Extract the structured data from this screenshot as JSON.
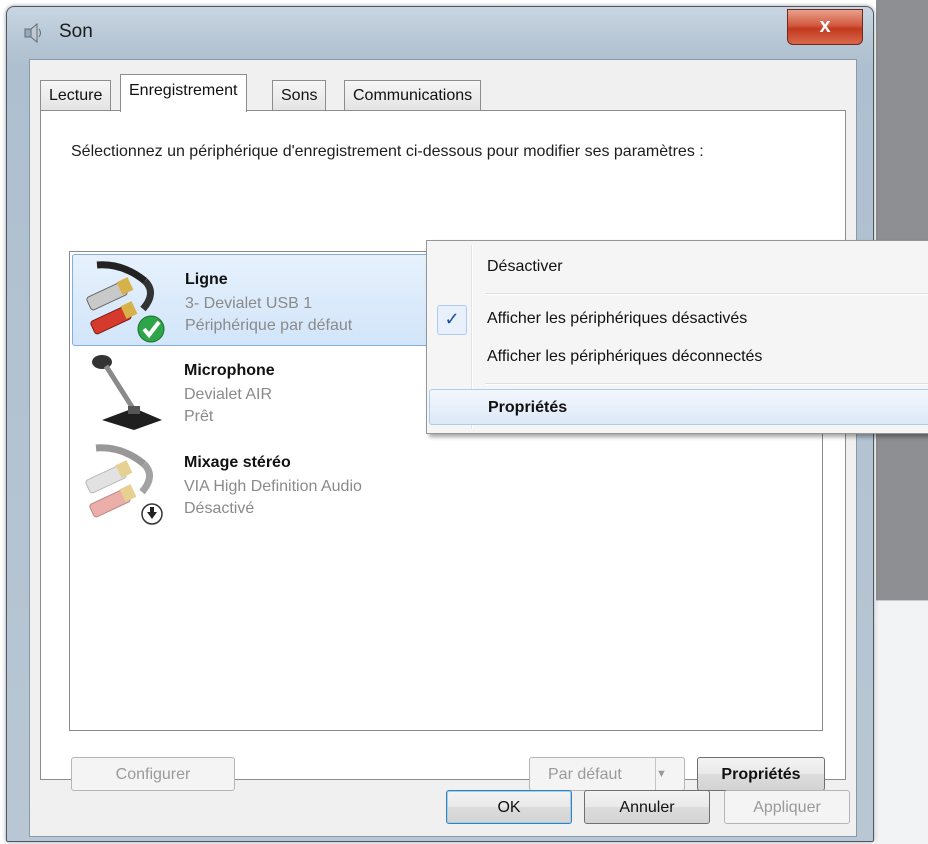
{
  "window": {
    "title": "Son",
    "close_glyph": "x"
  },
  "tabs": [
    {
      "label": "Lecture",
      "active": false
    },
    {
      "label": "Enregistrement",
      "active": true
    },
    {
      "label": "Sons",
      "active": false
    },
    {
      "label": "Communications",
      "active": false
    }
  ],
  "instructions": "Sélectionnez un périphérique d'enregistrement ci-dessous pour modifier ses paramètres :",
  "devices": [
    {
      "name": "Ligne",
      "detail": "3- Devialet USB 1",
      "status": "Périphérique par défaut",
      "icon": "line-in-jack-icon",
      "badge": "default-check-icon",
      "selected": true
    },
    {
      "name": "Microphone",
      "detail": "Devialet AIR",
      "status": "Prêt",
      "icon": "microphone-icon",
      "selected": false
    },
    {
      "name": "Mixage stéréo",
      "detail": "VIA High Definition Audio",
      "status": "Désactivé",
      "icon": "line-in-jack-icon",
      "badge": "disabled-arrow-icon",
      "selected": false
    }
  ],
  "context_menu": {
    "items": [
      {
        "label": "Désactiver"
      },
      {
        "label": "Afficher les périphériques désactivés",
        "checked": true
      },
      {
        "label": "Afficher les périphériques déconnectés"
      },
      {
        "label": "Propriétés",
        "bold": true,
        "hover": true
      }
    ],
    "check_glyph": "✓"
  },
  "panel_buttons": {
    "configure": "Configurer",
    "set_default": "Par défaut",
    "set_default_arrow": "▼",
    "properties": "Propriétés"
  },
  "dialog_buttons": {
    "ok": "OK",
    "cancel": "Annuler",
    "apply": "Appliquer"
  },
  "colors": {
    "selection": "#d2e5fa",
    "accent": "#3c7fb1",
    "close_button": "#c23a1f"
  }
}
